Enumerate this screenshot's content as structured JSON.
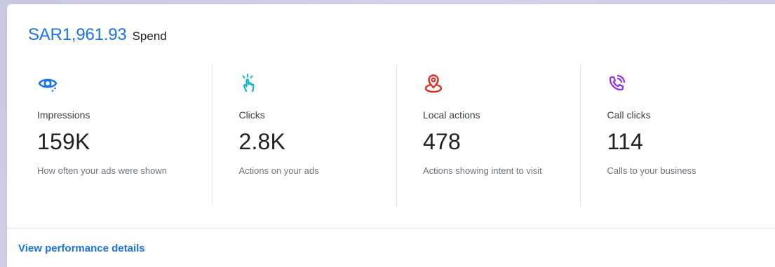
{
  "spend": {
    "amount": "SAR1,961.93",
    "label": "Spend"
  },
  "metrics": [
    {
      "icon": "eye-icon",
      "icon_color": "#1a73e8",
      "label": "Impressions",
      "value": "159K",
      "description": "How often your ads were shown"
    },
    {
      "icon": "tap-icon",
      "icon_color": "#12b5cb",
      "label": "Clicks",
      "value": "2.8K",
      "description": "Actions on your ads"
    },
    {
      "icon": "location-pin-icon",
      "icon_color": "#d93025",
      "label": "Local actions",
      "value": "478",
      "description": "Actions showing intent to visit"
    },
    {
      "icon": "phone-call-icon",
      "icon_color": "#9334e6",
      "label": "Call clicks",
      "value": "114",
      "description": "Calls to your business"
    }
  ],
  "footer": {
    "link_label": "View performance details"
  }
}
